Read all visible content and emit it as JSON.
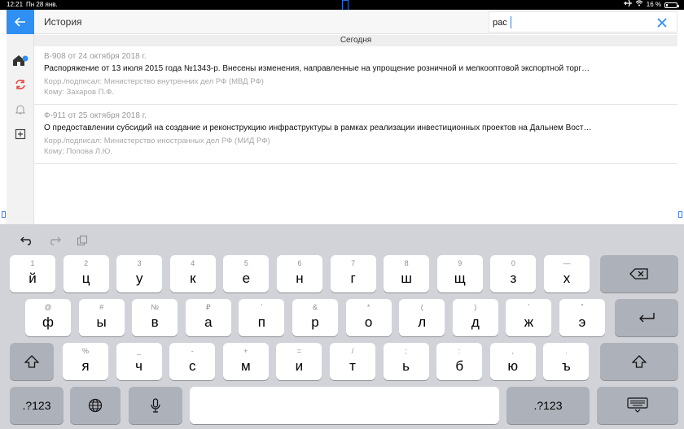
{
  "status": {
    "time": "12:21",
    "date": "Пн 28 янв.",
    "battery": "16 %",
    "battery_level": 0.16
  },
  "header": {
    "title": "История"
  },
  "search": {
    "value": "рас"
  },
  "section": {
    "label": "Сегодня"
  },
  "documents": [
    {
      "number": "В-908 от 24 октября 2018 г.",
      "subject": "Распоряжение от 13 июля 2015 года №1343-р. Внесены изменения, направленные на упрощение розничной и мелкооптовой экспортной торг…",
      "correspondent": "Корр./подписал: Министерство внутренних дел РФ (МВД РФ)",
      "recipient": "Кому: Захаров П.Ф."
    },
    {
      "number": "Ф-911 от 25 октября 2018 г.",
      "subject": "О предоставлении субсидий на создание и реконструкцию инфраструктуры в рамках реализации инвестиционных проектов на Дальнем Вост…",
      "correspondent": "Корр./подписал: Министерство иностранных дел РФ (МИД РФ)",
      "recipient": "Кому: Попова Л.Ю."
    }
  ],
  "keyboard": {
    "row1": [
      {
        "alt": "1",
        "char": "й"
      },
      {
        "alt": "2",
        "char": "ц"
      },
      {
        "alt": "3",
        "char": "у"
      },
      {
        "alt": "4",
        "char": "к"
      },
      {
        "alt": "5",
        "char": "е"
      },
      {
        "alt": "6",
        "char": "н"
      },
      {
        "alt": "7",
        "char": "г"
      },
      {
        "alt": "8",
        "char": "ш"
      },
      {
        "alt": "9",
        "char": "щ"
      },
      {
        "alt": "0",
        "char": "з"
      },
      {
        "alt": "—",
        "char": "х"
      }
    ],
    "row2": [
      {
        "alt": "@",
        "char": "ф"
      },
      {
        "alt": "#",
        "char": "ы"
      },
      {
        "alt": "№",
        "char": "в"
      },
      {
        "alt": "₽",
        "char": "а"
      },
      {
        "alt": "ʼ",
        "char": "п"
      },
      {
        "alt": "&",
        "char": "р"
      },
      {
        "alt": "*",
        "char": "о"
      },
      {
        "alt": "(",
        "char": "л"
      },
      {
        "alt": ")",
        "char": "д"
      },
      {
        "alt": "ʼ",
        "char": "ж"
      },
      {
        "alt": "ˮ",
        "char": "э"
      }
    ],
    "row3": [
      {
        "alt": "%",
        "char": "я"
      },
      {
        "alt": "_",
        "char": "ч"
      },
      {
        "alt": "-",
        "char": "с"
      },
      {
        "alt": "+",
        "char": "м"
      },
      {
        "alt": "=",
        "char": "и"
      },
      {
        "alt": "/",
        "char": "т"
      },
      {
        "alt": ";",
        "char": "ь"
      },
      {
        "alt": ":",
        "char": "б"
      },
      {
        "alt": ",",
        "char": "ю"
      },
      {
        "alt": ".",
        "char": "ъ"
      }
    ],
    "numbers_label": ".?123"
  },
  "colors": {
    "accent": "#2f8ff3",
    "badge": "#2f8ff3",
    "refresh": "#e8453c"
  }
}
